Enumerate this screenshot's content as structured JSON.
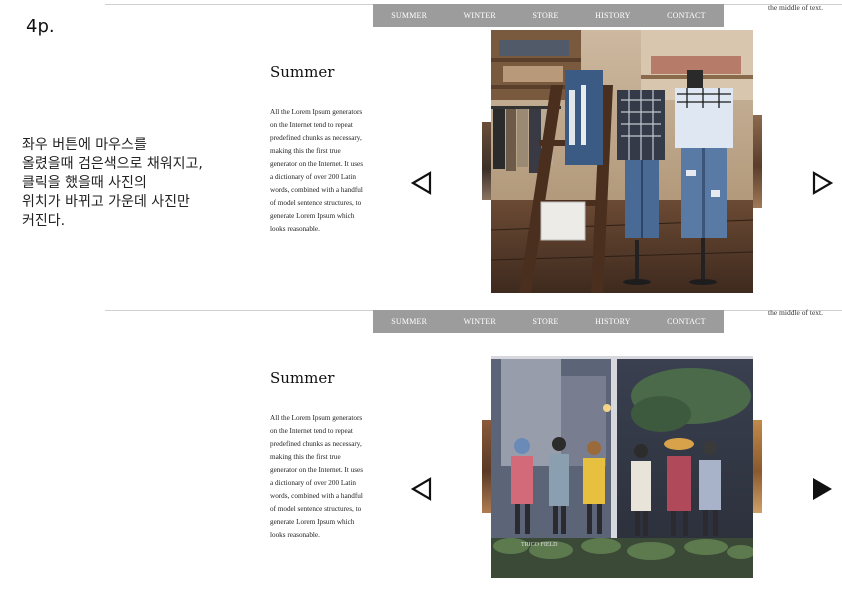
{
  "page_label": "4p.",
  "note": "좌우 버튼에 마우스를\n올렸을때 검은색으로 채워지고,\n클릭을 했을때 사진의\n위치가 바뀌고 가운데 사진만\n커진다.",
  "mockups": [
    {
      "nav": [
        "SUMMER",
        "WINTER",
        "STORE",
        "HISTORY",
        "CONTACT"
      ],
      "corner_text": "the middle of text.",
      "title": "Summer",
      "body": "All the Lorem Ipsum generators on the Internet tend to repeat predefined chunks as necessary, making this the first true generator on the Internet. It uses a dictionary of over 200 Latin words, combined with a handful of model sentence structures, to generate Lorem Ipsum which looks reasonable.",
      "left_arrow": "outline",
      "right_arrow": "outline",
      "image": "clothing-store-photo"
    },
    {
      "nav": [
        "SUMMER",
        "WINTER",
        "STORE",
        "HISTORY",
        "CONTACT"
      ],
      "corner_text": "the middle of text.",
      "title": "Summer",
      "body": "All the Lorem Ipsum generators on the Internet tend to repeat predefined chunks as necessary, making this the first true generator on the Internet. It uses a dictionary of over 200 Latin words, combined with a handful of model sentence structures, to generate Lorem Ipsum which looks reasonable.",
      "left_arrow": "outline",
      "right_arrow": "filled",
      "image": "shop-window-photo",
      "image_caption": "TRICO FIELD"
    }
  ],
  "colors": {
    "nav_bg": "#9c9c9c",
    "nav_text": "#ffffff",
    "divider": "#cfcfcf"
  }
}
